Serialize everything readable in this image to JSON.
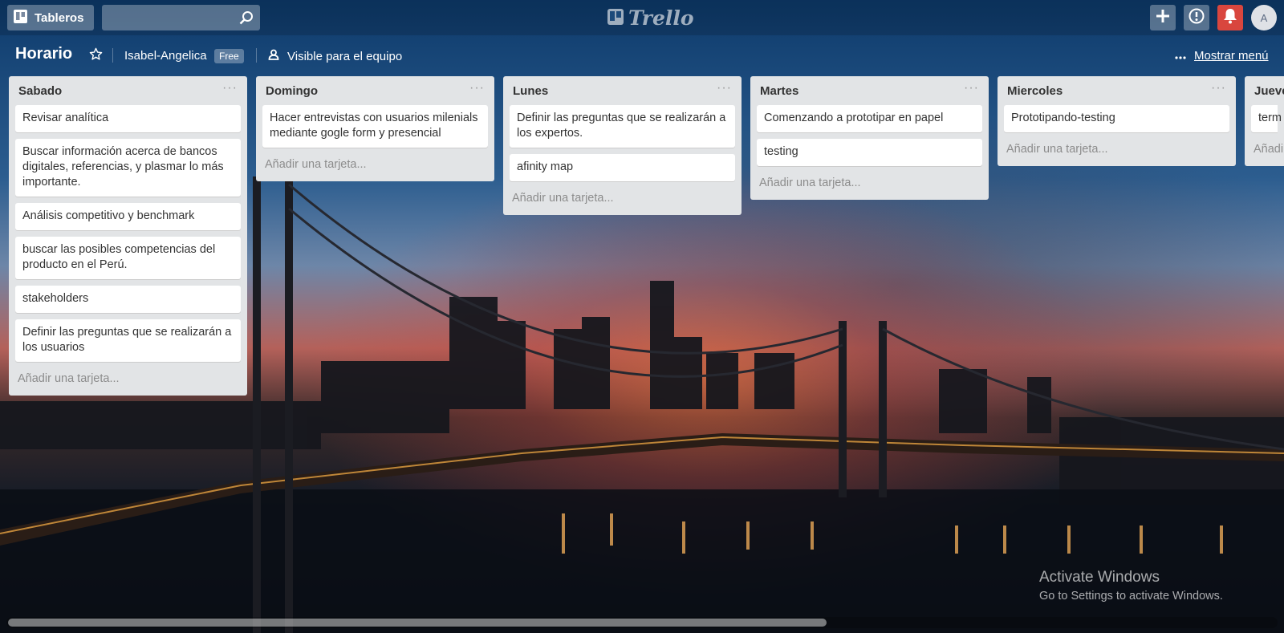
{
  "header": {
    "boards_label": "Tableros",
    "search": {
      "value": "",
      "placeholder": ""
    },
    "logo_text": "Trello",
    "avatar_initial": "A"
  },
  "board": {
    "title": "Horario",
    "team": "Isabel-Angelica",
    "team_badge": "Free",
    "visibility": "Visible para el equipo",
    "menu_label": "Mostrar menú"
  },
  "lists": [
    {
      "title": "Sabado",
      "cards": [
        "Revisar analítica",
        "Buscar información acerca de bancos digitales, referencias, y plasmar lo más importante.",
        "Análisis competitivo y benchmark",
        "buscar las posibles competencias del producto en el Perú.",
        "stakeholders",
        "Definir las preguntas que se realizarán a los usuarios"
      ],
      "add_label": "Añadir una tarjeta..."
    },
    {
      "title": "Domingo",
      "cards": [
        "Hacer entrevistas con usuarios milenials mediante gogle form y presencial"
      ],
      "add_label": "Añadir una tarjeta..."
    },
    {
      "title": "Lunes",
      "cards": [
        "Definir las preguntas que se realizarán a los expertos.",
        "afinity map"
      ],
      "add_label": "Añadir una tarjeta..."
    },
    {
      "title": "Martes",
      "cards": [
        "Comenzando a prototipar en papel",
        "testing"
      ],
      "add_label": "Añadir una tarjeta..."
    },
    {
      "title": "Miercoles",
      "cards": [
        "Prototipando-testing"
      ],
      "add_label": "Añadir una tarjeta..."
    },
    {
      "title": "Jueves",
      "cards": [
        "term"
      ],
      "add_label": "Añadi"
    }
  ],
  "watermark": {
    "line1": "Activate Windows",
    "line2": "Go to Settings to activate Windows."
  },
  "colors": {
    "list_bg": "#e2e4e6",
    "notification_red": "#d9463e"
  }
}
